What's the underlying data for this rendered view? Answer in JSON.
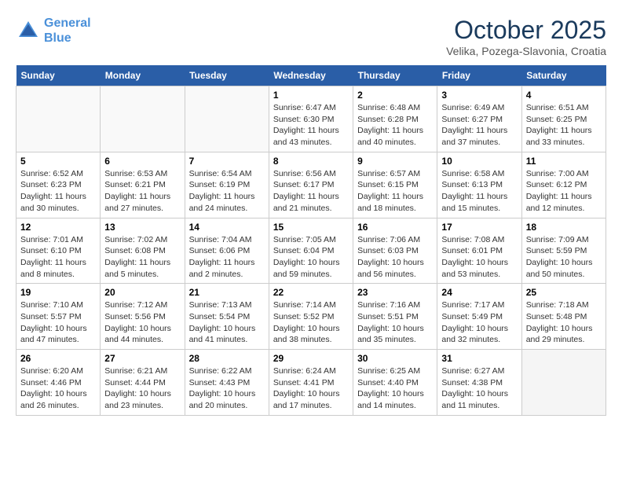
{
  "header": {
    "logo_line1": "General",
    "logo_line2": "Blue",
    "month": "October 2025",
    "location": "Velika, Pozega-Slavonia, Croatia"
  },
  "days_of_week": [
    "Sunday",
    "Monday",
    "Tuesday",
    "Wednesday",
    "Thursday",
    "Friday",
    "Saturday"
  ],
  "weeks": [
    [
      {
        "day": "",
        "info": ""
      },
      {
        "day": "",
        "info": ""
      },
      {
        "day": "",
        "info": ""
      },
      {
        "day": "1",
        "info": "Sunrise: 6:47 AM\nSunset: 6:30 PM\nDaylight: 11 hours\nand 43 minutes."
      },
      {
        "day": "2",
        "info": "Sunrise: 6:48 AM\nSunset: 6:28 PM\nDaylight: 11 hours\nand 40 minutes."
      },
      {
        "day": "3",
        "info": "Sunrise: 6:49 AM\nSunset: 6:27 PM\nDaylight: 11 hours\nand 37 minutes."
      },
      {
        "day": "4",
        "info": "Sunrise: 6:51 AM\nSunset: 6:25 PM\nDaylight: 11 hours\nand 33 minutes."
      }
    ],
    [
      {
        "day": "5",
        "info": "Sunrise: 6:52 AM\nSunset: 6:23 PM\nDaylight: 11 hours\nand 30 minutes."
      },
      {
        "day": "6",
        "info": "Sunrise: 6:53 AM\nSunset: 6:21 PM\nDaylight: 11 hours\nand 27 minutes."
      },
      {
        "day": "7",
        "info": "Sunrise: 6:54 AM\nSunset: 6:19 PM\nDaylight: 11 hours\nand 24 minutes."
      },
      {
        "day": "8",
        "info": "Sunrise: 6:56 AM\nSunset: 6:17 PM\nDaylight: 11 hours\nand 21 minutes."
      },
      {
        "day": "9",
        "info": "Sunrise: 6:57 AM\nSunset: 6:15 PM\nDaylight: 11 hours\nand 18 minutes."
      },
      {
        "day": "10",
        "info": "Sunrise: 6:58 AM\nSunset: 6:13 PM\nDaylight: 11 hours\nand 15 minutes."
      },
      {
        "day": "11",
        "info": "Sunrise: 7:00 AM\nSunset: 6:12 PM\nDaylight: 11 hours\nand 12 minutes."
      }
    ],
    [
      {
        "day": "12",
        "info": "Sunrise: 7:01 AM\nSunset: 6:10 PM\nDaylight: 11 hours\nand 8 minutes."
      },
      {
        "day": "13",
        "info": "Sunrise: 7:02 AM\nSunset: 6:08 PM\nDaylight: 11 hours\nand 5 minutes."
      },
      {
        "day": "14",
        "info": "Sunrise: 7:04 AM\nSunset: 6:06 PM\nDaylight: 11 hours\nand 2 minutes."
      },
      {
        "day": "15",
        "info": "Sunrise: 7:05 AM\nSunset: 6:04 PM\nDaylight: 10 hours\nand 59 minutes."
      },
      {
        "day": "16",
        "info": "Sunrise: 7:06 AM\nSunset: 6:03 PM\nDaylight: 10 hours\nand 56 minutes."
      },
      {
        "day": "17",
        "info": "Sunrise: 7:08 AM\nSunset: 6:01 PM\nDaylight: 10 hours\nand 53 minutes."
      },
      {
        "day": "18",
        "info": "Sunrise: 7:09 AM\nSunset: 5:59 PM\nDaylight: 10 hours\nand 50 minutes."
      }
    ],
    [
      {
        "day": "19",
        "info": "Sunrise: 7:10 AM\nSunset: 5:57 PM\nDaylight: 10 hours\nand 47 minutes."
      },
      {
        "day": "20",
        "info": "Sunrise: 7:12 AM\nSunset: 5:56 PM\nDaylight: 10 hours\nand 44 minutes."
      },
      {
        "day": "21",
        "info": "Sunrise: 7:13 AM\nSunset: 5:54 PM\nDaylight: 10 hours\nand 41 minutes."
      },
      {
        "day": "22",
        "info": "Sunrise: 7:14 AM\nSunset: 5:52 PM\nDaylight: 10 hours\nand 38 minutes."
      },
      {
        "day": "23",
        "info": "Sunrise: 7:16 AM\nSunset: 5:51 PM\nDaylight: 10 hours\nand 35 minutes."
      },
      {
        "day": "24",
        "info": "Sunrise: 7:17 AM\nSunset: 5:49 PM\nDaylight: 10 hours\nand 32 minutes."
      },
      {
        "day": "25",
        "info": "Sunrise: 7:18 AM\nSunset: 5:48 PM\nDaylight: 10 hours\nand 29 minutes."
      }
    ],
    [
      {
        "day": "26",
        "info": "Sunrise: 6:20 AM\nSunset: 4:46 PM\nDaylight: 10 hours\nand 26 minutes."
      },
      {
        "day": "27",
        "info": "Sunrise: 6:21 AM\nSunset: 4:44 PM\nDaylight: 10 hours\nand 23 minutes."
      },
      {
        "day": "28",
        "info": "Sunrise: 6:22 AM\nSunset: 4:43 PM\nDaylight: 10 hours\nand 20 minutes."
      },
      {
        "day": "29",
        "info": "Sunrise: 6:24 AM\nSunset: 4:41 PM\nDaylight: 10 hours\nand 17 minutes."
      },
      {
        "day": "30",
        "info": "Sunrise: 6:25 AM\nSunset: 4:40 PM\nDaylight: 10 hours\nand 14 minutes."
      },
      {
        "day": "31",
        "info": "Sunrise: 6:27 AM\nSunset: 4:38 PM\nDaylight: 10 hours\nand 11 minutes."
      },
      {
        "day": "",
        "info": ""
      }
    ]
  ]
}
